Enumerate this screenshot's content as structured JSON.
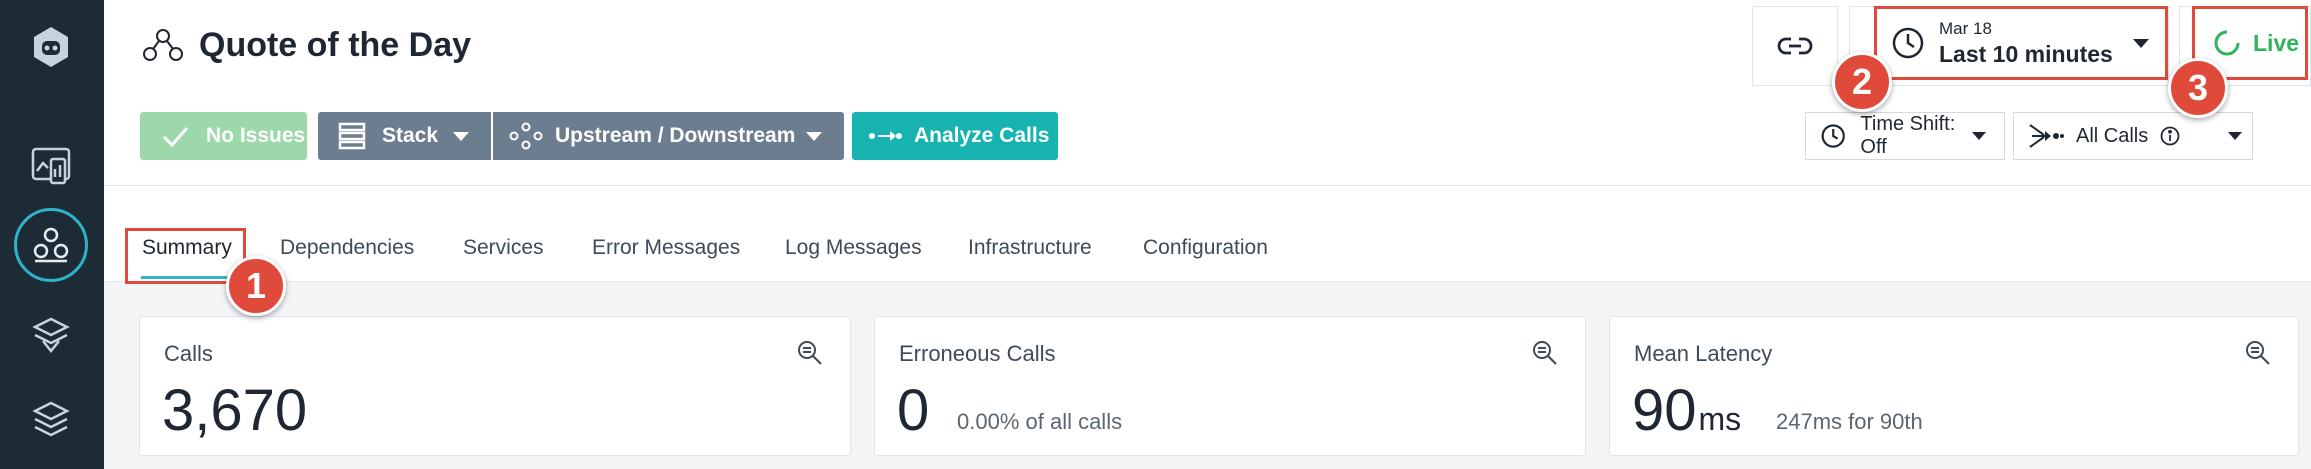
{
  "header": {
    "title": "Quote of the Day"
  },
  "toolbar": {
    "no_issues": "No Issues",
    "stack": "Stack",
    "upstream_downstream": "Upstream / Downstream",
    "analyze_calls": "Analyze Calls"
  },
  "time_selector": {
    "date": "Mar 18",
    "range": "Last 10 minutes"
  },
  "live": {
    "label": "Live"
  },
  "time_shift": {
    "label": "Time Shift: Off"
  },
  "call_filter": {
    "label": "All Calls"
  },
  "tabs": [
    {
      "label": "Summary",
      "active": true
    },
    {
      "label": "Dependencies"
    },
    {
      "label": "Services"
    },
    {
      "label": "Error Messages"
    },
    {
      "label": "Log Messages"
    },
    {
      "label": "Infrastructure"
    },
    {
      "label": "Configuration"
    }
  ],
  "cards": {
    "calls": {
      "title": "Calls",
      "value": "3,670"
    },
    "erroneous": {
      "title": "Erroneous Calls",
      "value": "0",
      "sub": "0.00% of all calls"
    },
    "latency": {
      "title": "Mean Latency",
      "value": "90",
      "unit": "ms",
      "sub": "247ms for 90th"
    }
  },
  "callouts": [
    "1",
    "2",
    "3"
  ],
  "colors": {
    "sidebar": "#1c2b36",
    "accent_teal": "#17b3b0",
    "highlight_red": "#e04a3b",
    "success_green": "#2fb35c"
  },
  "icons": {
    "sidebar": [
      "robot-logo-icon",
      "dashboard-icon",
      "application-icon",
      "service-icon",
      "infrastructure-icon"
    ],
    "toolbar": [
      "check-icon",
      "stack-icon",
      "upstream-downstream-icon",
      "analyze-calls-icon",
      "link-icon",
      "clock-icon",
      "live-spinner-icon",
      "info-icon",
      "magnifier-icon"
    ]
  }
}
